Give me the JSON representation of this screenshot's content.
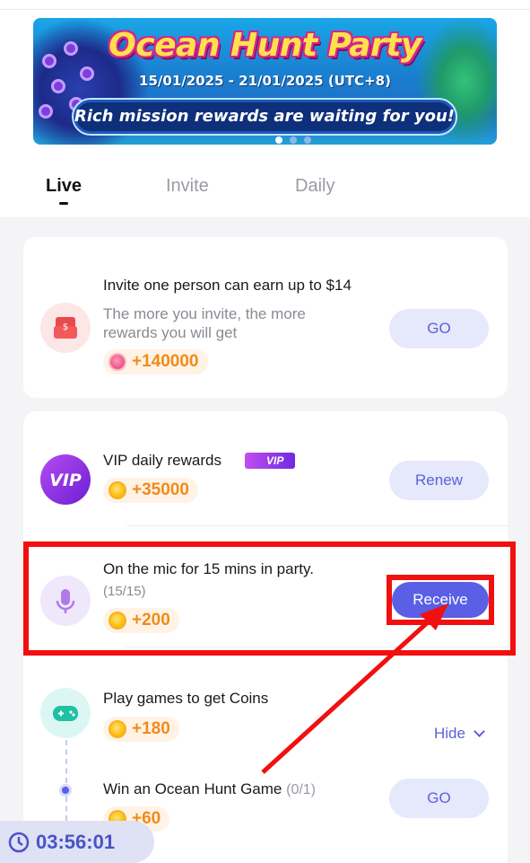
{
  "banner": {
    "title": "Ocean Hunt Party",
    "dates": "15/01/2025 - 21/01/2025 (UTC+8)",
    "tagline": "Rich mission rewards are waiting for you!"
  },
  "tabs": [
    {
      "label": "Live",
      "active": true
    },
    {
      "label": "Invite",
      "active": false
    },
    {
      "label": "Daily",
      "active": false
    }
  ],
  "invite_card": {
    "icon": "envelope-money-icon",
    "title": "Invite one person can earn up to $14",
    "desc_line1": "The more you invite, the more",
    "desc_line2": "rewards you will get",
    "reward": "+140000",
    "button": "GO"
  },
  "tasks": [
    {
      "icon": "vip-icon",
      "title": "VIP daily rewards",
      "badge": "VIP",
      "reward": "+35000",
      "button": "Renew"
    },
    {
      "icon": "microphone-icon",
      "title": "On the mic for 15 mins in party.",
      "progress": "(15/15)",
      "reward": "+200",
      "button": "Receive"
    },
    {
      "icon": "gamepad-icon",
      "title": "Play games to get Coins",
      "reward": "+180",
      "toggle": "Hide"
    },
    {
      "title": "Win an Ocean Hunt Game",
      "progress": "(0/1)",
      "reward": "+60",
      "button": "GO"
    }
  ],
  "timer": "03:56:01",
  "colors": {
    "accent": "#5a5fe6",
    "coin": "#f28a1a",
    "highlight": "#f20f0f"
  }
}
